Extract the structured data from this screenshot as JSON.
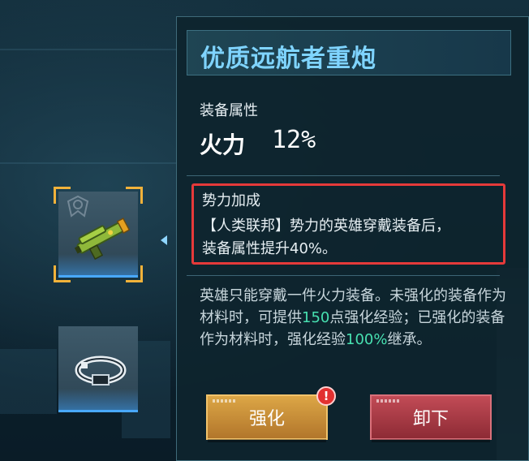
{
  "item": {
    "title": "优质远航者重炮"
  },
  "attributes": {
    "label": "装备属性",
    "stat_name": "火力",
    "stat_value": "12%"
  },
  "faction_bonus": {
    "label": "势力加成",
    "line1": "【人类联邦】势力的英雄穿戴装备后，",
    "line2": "装备属性提升40%。"
  },
  "description": {
    "part1": "英雄只能穿戴一件火力装备。未强化的装备作为材料时，可提供",
    "exp_value": "150",
    "part2": "点强化经验；已强化的装备作为材料时，强化经验",
    "inherit_value": "100%",
    "part3": "继承。"
  },
  "buttons": {
    "enhance_label": "强化",
    "enhance_alert": "!",
    "unequip_label": "卸下"
  },
  "icons": {
    "slot1": "heavy-cannon-icon",
    "slot2": "armor-bracelet-icon",
    "faction": "federation-emblem-icon"
  },
  "colors": {
    "title": "#7fd4ff",
    "highlight": "#47e0b0",
    "enhance_button": "#c98d3a",
    "unequip_button": "#a93a45",
    "selection_corner": "#f2b23a",
    "bonus_border": "#e53a3a"
  }
}
